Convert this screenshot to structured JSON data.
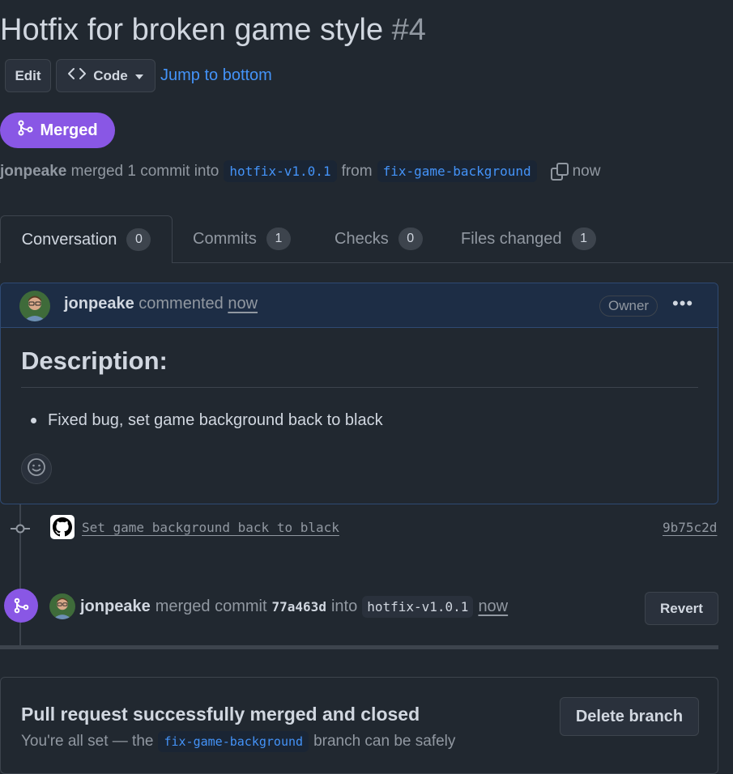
{
  "pr": {
    "title": "Hotfix for broken game style",
    "number": "#4",
    "state": "Merged",
    "author": "jonpeake",
    "merge_text": "merged 1 commit into",
    "base_branch": "hotfix-v1.0.1",
    "from_text": "from",
    "head_branch": "fix-game-background",
    "time": "now"
  },
  "toolbar": {
    "edit_label": "Edit",
    "code_label": "Code",
    "jump_label": "Jump to bottom"
  },
  "tabs": [
    {
      "label": "Conversation",
      "count": "0"
    },
    {
      "label": "Commits",
      "count": "1"
    },
    {
      "label": "Checks",
      "count": "0"
    },
    {
      "label": "Files changed",
      "count": "1"
    }
  ],
  "comment": {
    "author": "jonpeake",
    "action": "commented",
    "time": "now",
    "role": "Owner",
    "heading": "Description:",
    "bullet": "Fixed bug, set game background back to black"
  },
  "commit": {
    "message": "Set game background back to black",
    "sha": "9b75c2d"
  },
  "merge_event": {
    "author": "jonpeake",
    "text": "merged commit",
    "sha": "77a463d",
    "into": "into",
    "branch": "hotfix-v1.0.1",
    "time": "now",
    "revert_label": "Revert"
  },
  "merged_box": {
    "title": "Pull request successfully merged and closed",
    "desc_prefix": "You're all set — the",
    "branch": "fix-game-background",
    "desc_suffix": "branch can be safely",
    "delete_label": "Delete branch"
  },
  "colors": {
    "background": "#212830",
    "accent_link": "#4493f8",
    "merged_purple": "#8957e5",
    "comment_header": "#1d2d45"
  }
}
